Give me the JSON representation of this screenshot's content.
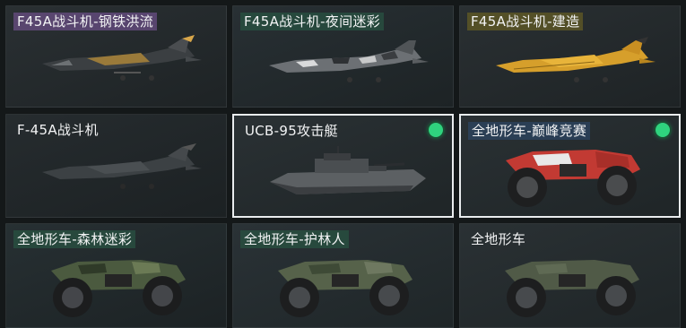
{
  "vehicles": [
    {
      "name": "F45A战斗机-钢铁洪流",
      "type": "jet",
      "skin": "steel",
      "equipped": false,
      "selected": false,
      "tag": "purple"
    },
    {
      "name": "F45A战斗机-夜间迷彩",
      "type": "jet",
      "skin": "nightcamo",
      "equipped": false,
      "selected": false,
      "tag": "teal"
    },
    {
      "name": "F45A战斗机-建造",
      "type": "jet",
      "skin": "yellow",
      "equipped": false,
      "selected": false,
      "tag": "olive"
    },
    {
      "name": "F-45A战斗机",
      "type": "jet",
      "skin": "dark",
      "equipped": false,
      "selected": false,
      "tag": "none"
    },
    {
      "name": "UCB-95攻击艇",
      "type": "boat",
      "skin": "grey",
      "equipped": true,
      "selected": true,
      "tag": "none"
    },
    {
      "name": "全地形车-巅峰竞赛",
      "type": "atv",
      "skin": "red",
      "equipped": true,
      "selected": true,
      "tag": "blue"
    },
    {
      "name": "全地形车-森林迷彩",
      "type": "atv",
      "skin": "forest",
      "equipped": false,
      "selected": false,
      "tag": "teal"
    },
    {
      "name": "全地形车-护林人",
      "type": "atv",
      "skin": "ranger",
      "equipped": false,
      "selected": false,
      "tag": "teal"
    },
    {
      "name": "全地形车",
      "type": "atv",
      "skin": "default",
      "equipped": false,
      "selected": false,
      "tag": "none"
    }
  ],
  "colors": {
    "equipped_indicator": "#2fd37e",
    "selected_border": "#e9ecee",
    "card_background": "#23292c",
    "title_text": "#f2f3f4"
  }
}
